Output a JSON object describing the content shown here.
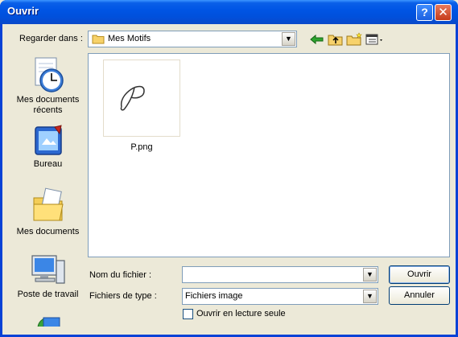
{
  "window": {
    "title": "Ouvrir",
    "help_glyph": "?",
    "close_glyph": "✕"
  },
  "toolbar": {
    "look_in_label": "Regarder dans :",
    "look_in_value": "Mes Motifs"
  },
  "places": [
    {
      "label": "Mes documents récents"
    },
    {
      "label": "Bureau"
    },
    {
      "label": "Mes documents"
    },
    {
      "label": "Poste de travail"
    }
  ],
  "files": [
    {
      "name": "P.png"
    }
  ],
  "form": {
    "filename_label": "Nom du fichier :",
    "filename_value": "",
    "filetype_label": "Fichiers de type :",
    "filetype_value": "Fichiers image",
    "readonly_label": "Ouvrir en lecture seule"
  },
  "buttons": {
    "open": "Ouvrir",
    "cancel": "Annuler"
  }
}
